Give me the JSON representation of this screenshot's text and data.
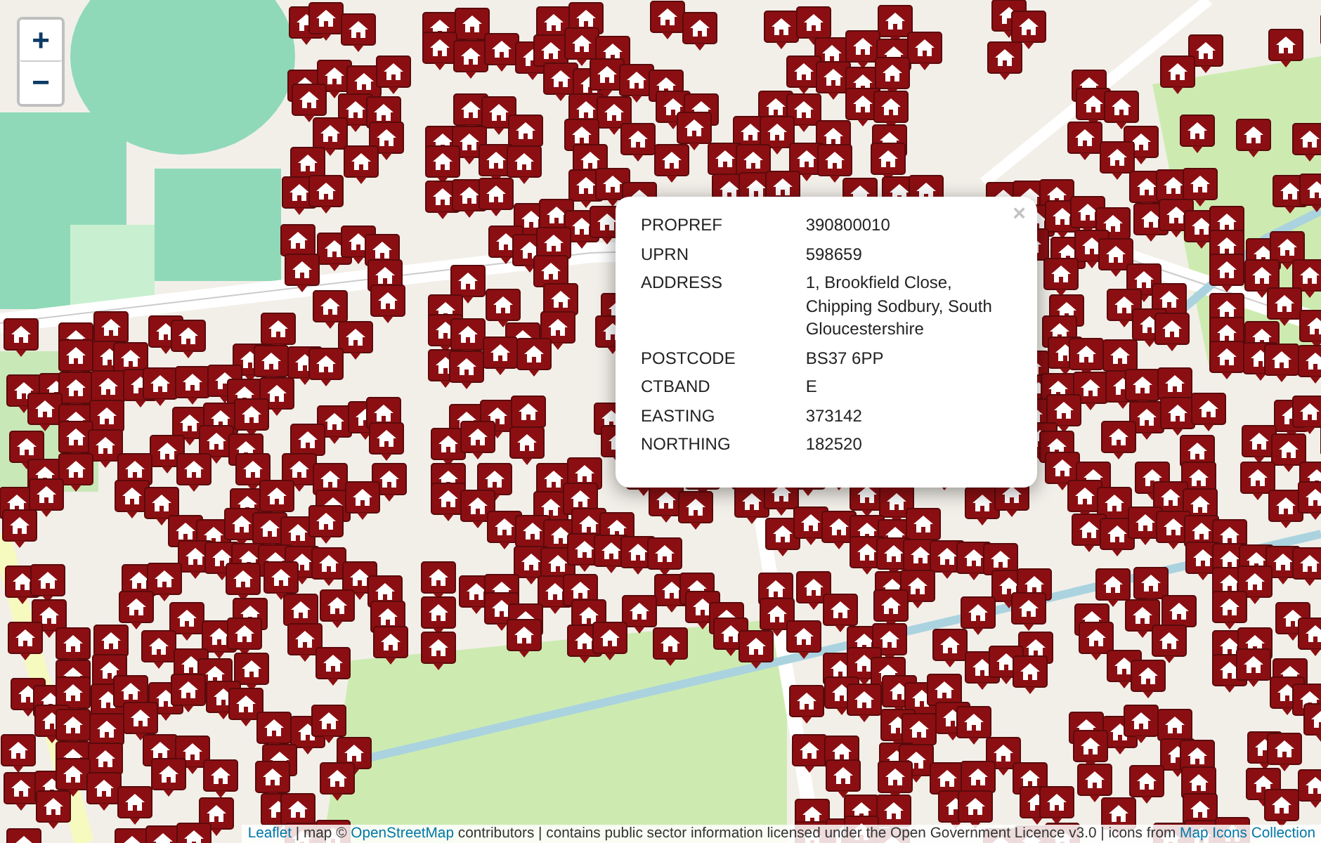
{
  "zoom_controls": [
    {
      "label": "+"
    },
    {
      "label": "−"
    }
  ],
  "popup": {
    "close": "×",
    "rows": [
      {
        "key": "PROPREF",
        "value": "390800010"
      },
      {
        "key": "UPRN",
        "value": "598659"
      },
      {
        "key": "ADDRESS",
        "value": "1, Brookfield Close, Chipping Sodbury, South Gloucestershire"
      },
      {
        "key": "POSTCODE",
        "value": "BS37 6PP"
      },
      {
        "key": "CTBAND",
        "value": "E"
      },
      {
        "key": "EASTING",
        "value": "373142"
      },
      {
        "key": "NORTHING",
        "value": "182520"
      }
    ]
  },
  "attribution": [
    {
      "kind": "link",
      "text": "Leaflet"
    },
    {
      "kind": "text",
      "text": " | map © "
    },
    {
      "kind": "link",
      "text": "OpenStreetMap"
    },
    {
      "kind": "text",
      "text": " contributors | contains public sector information licensed under the Open Government Licence v3.0 | icons from "
    },
    {
      "kind": "link",
      "text": "Map Icons Collection"
    }
  ]
}
